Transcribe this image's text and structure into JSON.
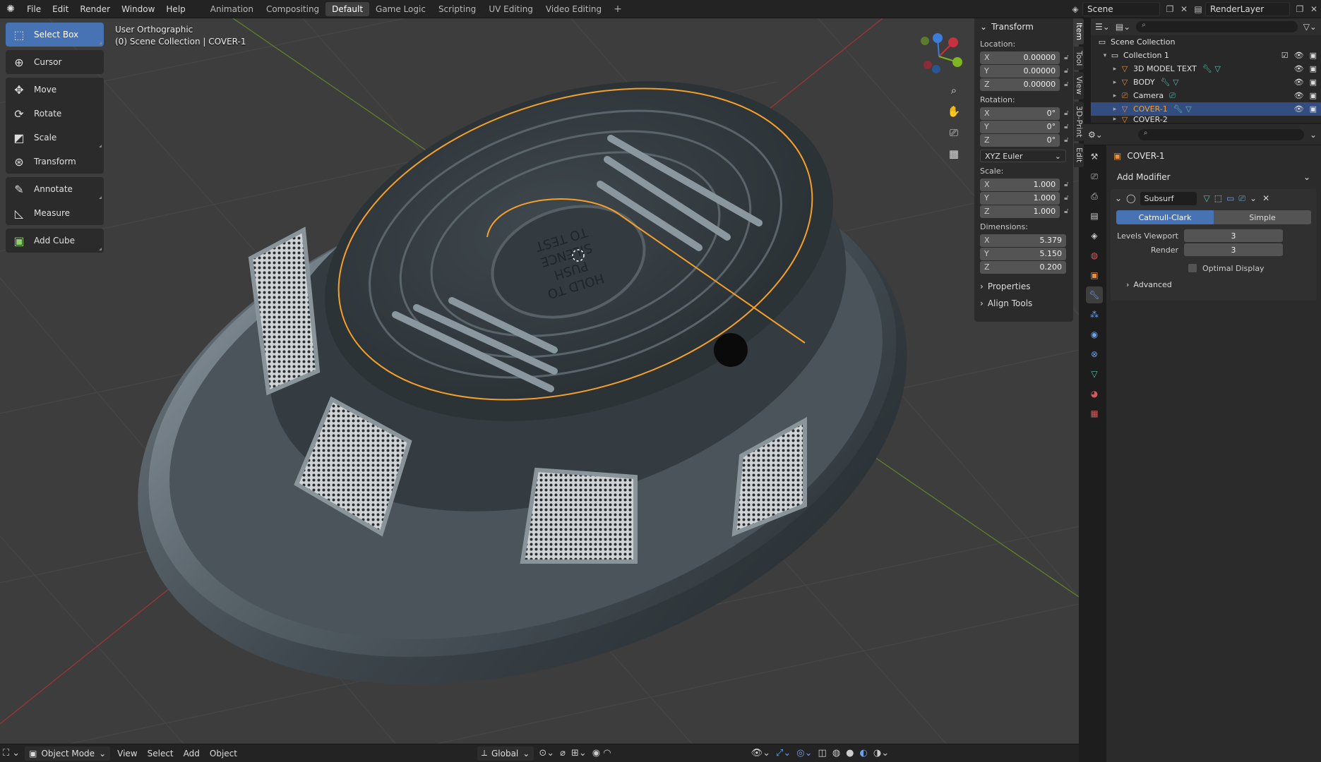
{
  "topbar": {
    "menus": [
      "File",
      "Edit",
      "Render",
      "Window",
      "Help"
    ],
    "workspaces": [
      "Animation",
      "Compositing",
      "Default",
      "Game Logic",
      "Scripting",
      "UV Editing",
      "Video Editing"
    ],
    "active_workspace": "Default",
    "add_workspace": "+",
    "scene": "Scene",
    "render_layer": "RenderLayer"
  },
  "viewport": {
    "view_name": "User Orthographic",
    "collection_path": "(0) Scene Collection | COVER-1",
    "embossed_text": [
      "HOLD TO",
      "PUSH",
      "SILENCE",
      "TO TEST"
    ]
  },
  "toolbar": {
    "tools": [
      {
        "label": "Select Box",
        "icon": "select-box-icon"
      },
      {
        "label": "Cursor",
        "icon": "cursor-icon"
      },
      {
        "label": "Move",
        "icon": "move-icon"
      },
      {
        "label": "Rotate",
        "icon": "rotate-icon"
      },
      {
        "label": "Scale",
        "icon": "scale-icon"
      },
      {
        "label": "Transform",
        "icon": "transform-icon"
      },
      {
        "label": "Annotate",
        "icon": "annotate-icon"
      },
      {
        "label": "Measure",
        "icon": "measure-icon"
      },
      {
        "label": "Add Cube",
        "icon": "add-cube-icon"
      }
    ],
    "active": "Select Box"
  },
  "npanel": {
    "header": "Transform",
    "location_label": "Location:",
    "location": {
      "x": "0.00000",
      "y": "0.00000",
      "z": "0.00000"
    },
    "rotation_label": "Rotation:",
    "rotation": {
      "x": "0°",
      "y": "0°",
      "z": "0°"
    },
    "rotation_mode": "XYZ Euler",
    "scale_label": "Scale:",
    "scale": {
      "x": "1.000",
      "y": "1.000",
      "z": "1.000"
    },
    "dimensions_label": "Dimensions:",
    "dimensions": {
      "x": "5.379",
      "y": "5.150",
      "z": "0.200"
    },
    "axis": {
      "x": "X",
      "y": "Y",
      "z": "Z"
    },
    "properties": "Properties",
    "align_tools": "Align Tools",
    "tabs": [
      "Item",
      "Tool",
      "View",
      "3D-Print",
      "Edit"
    ]
  },
  "bottombar": {
    "mode": "Object Mode",
    "menus": [
      "View",
      "Select",
      "Add",
      "Object"
    ],
    "orientation": "Global"
  },
  "outliner": {
    "root": "Scene Collection",
    "items": [
      {
        "name": "Collection 1",
        "icon": "collection-icon",
        "color": "#d0d0d0"
      },
      {
        "name": "3D MODEL TEXT",
        "icon": "mesh-object-icon",
        "color": "#e8903c"
      },
      {
        "name": "BODY",
        "icon": "mesh-object-icon",
        "color": "#e8903c"
      },
      {
        "name": "Camera",
        "icon": "camera-object-icon",
        "color": "#e8903c"
      },
      {
        "name": "COVER-1",
        "icon": "mesh-object-icon",
        "color": "#e8903c"
      },
      {
        "name": "COVER-2",
        "icon": "mesh-object-icon",
        "color": "#e8903c"
      }
    ],
    "selected": "COVER-1"
  },
  "properties": {
    "object_name": "COVER-1",
    "add_modifier": "Add Modifier",
    "modifier": {
      "name": "Subsurf",
      "type_on": "Catmull-Clark",
      "type_off": "Simple",
      "levels_viewport_label": "Levels Viewport",
      "levels_viewport": "3",
      "render_label": "Render",
      "render": "3",
      "optimal_display": "Optimal Display",
      "advanced": "Advanced"
    }
  },
  "colors": {
    "accent": "#4772b3",
    "selection_outline": "#f5a02a",
    "x_axis": "#c8323e",
    "y_axis": "#7fb520"
  }
}
